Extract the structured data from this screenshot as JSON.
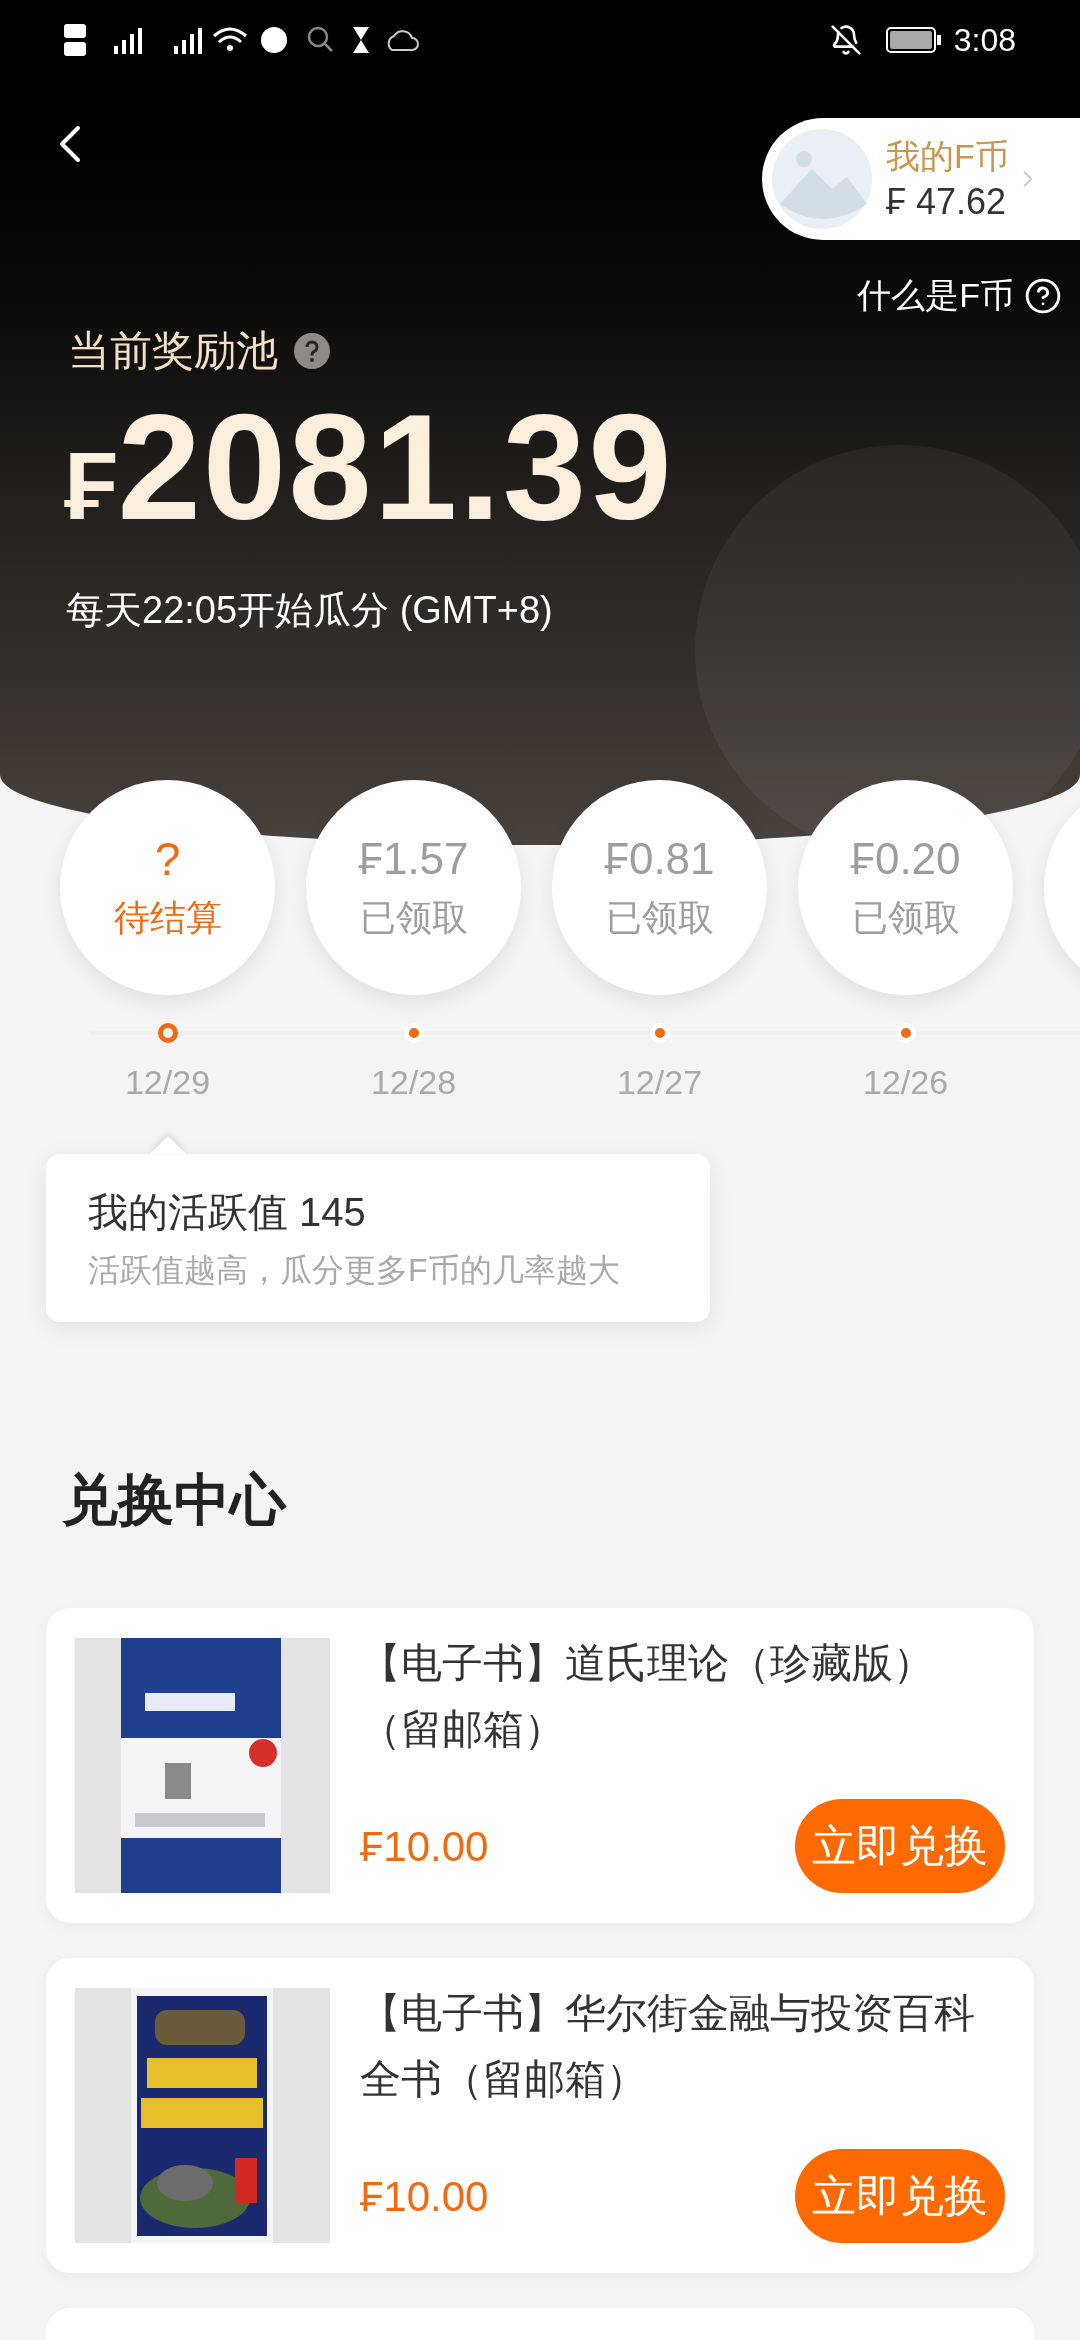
{
  "status_bar": {
    "time": "3:08"
  },
  "header": {
    "wallet": {
      "title": "我的F币",
      "currency": "₣",
      "amount": "47.62"
    },
    "help_link": "什么是F币",
    "pool_label": "当前奖励池",
    "pool_currency": "₣",
    "pool_amount": "2081.39",
    "schedule": "每天22:05开始瓜分 (GMT+8)"
  },
  "days": [
    {
      "kind": "pending",
      "top": "?",
      "label": "待结算",
      "date": "12/29",
      "selected": true
    },
    {
      "kind": "claimed",
      "currency": "₣",
      "amount": "1.57",
      "label": "已领取",
      "date": "12/28",
      "selected": false
    },
    {
      "kind": "claimed",
      "currency": "₣",
      "amount": "0.81",
      "label": "已领取",
      "date": "12/27",
      "selected": false
    },
    {
      "kind": "claimed",
      "currency": "₣",
      "amount": "0.20",
      "label": "已领取",
      "date": "12/26",
      "selected": false
    }
  ],
  "activity": {
    "title": "我的活跃值 145",
    "hint": "活跃值越高，瓜分更多F币的几率越大"
  },
  "exchange": {
    "title": "兑换中心",
    "items": [
      {
        "name": "【电子书】道氏理论（珍藏版）（留邮箱）",
        "price": "₣10.00",
        "button": "立即兑换"
      },
      {
        "name": "【电子书】华尔街金融与投资百科全书（留邮箱）",
        "price": "₣10.00",
        "button": "立即兑换"
      }
    ]
  }
}
